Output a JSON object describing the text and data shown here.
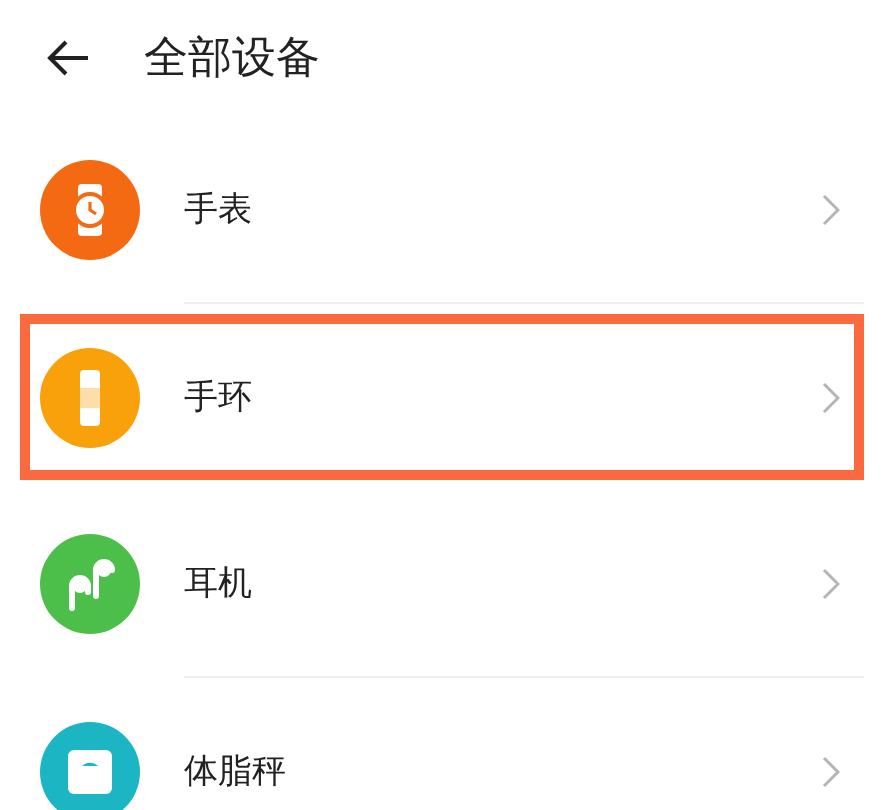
{
  "header": {
    "title": "全部设备"
  },
  "devices": [
    {
      "label": "手表",
      "kind": "watch",
      "color": "#f36a12",
      "highlighted": false
    },
    {
      "label": "手环",
      "kind": "band",
      "color": "#f8a10b",
      "highlighted": true
    },
    {
      "label": "耳机",
      "kind": "earphones",
      "color": "#4cbf4a",
      "highlighted": false
    },
    {
      "label": "体脂秤",
      "kind": "scale",
      "color": "#1bb5c4",
      "highlighted": false
    }
  ]
}
